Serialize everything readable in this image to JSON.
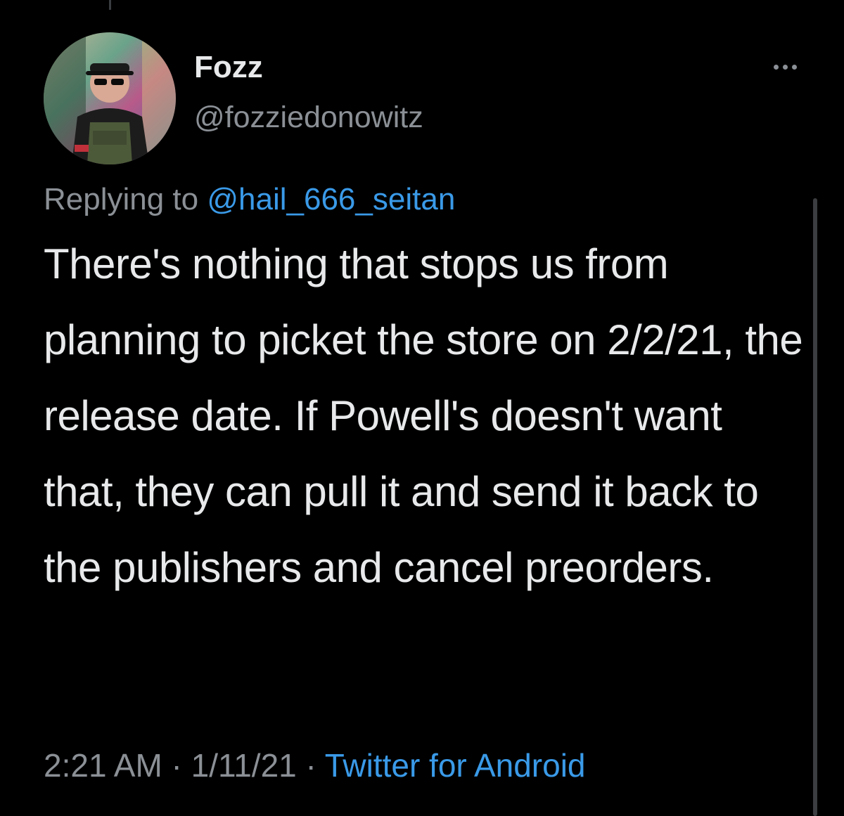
{
  "author": {
    "display_name": "Fozz",
    "handle": "@fozziedonowitz"
  },
  "more_icon": "more-horizontal-icon",
  "reply": {
    "prefix": "Replying to ",
    "to_handle": "@hail_666_seitan"
  },
  "tweet": {
    "text": "There's nothing that stops us from planning to picket the store on 2/2/21, the release date. If Powell's doesn't want that, they can pull it and send it back to the publishers and cancel preorders."
  },
  "meta": {
    "time": "2:21 AM",
    "separator": " · ",
    "date": "1/11/21",
    "source": "Twitter for Android"
  },
  "colors": {
    "background": "#000000",
    "text": "#e7e9ea",
    "secondary_text": "#8b9096",
    "link": "#3a9ae8"
  }
}
